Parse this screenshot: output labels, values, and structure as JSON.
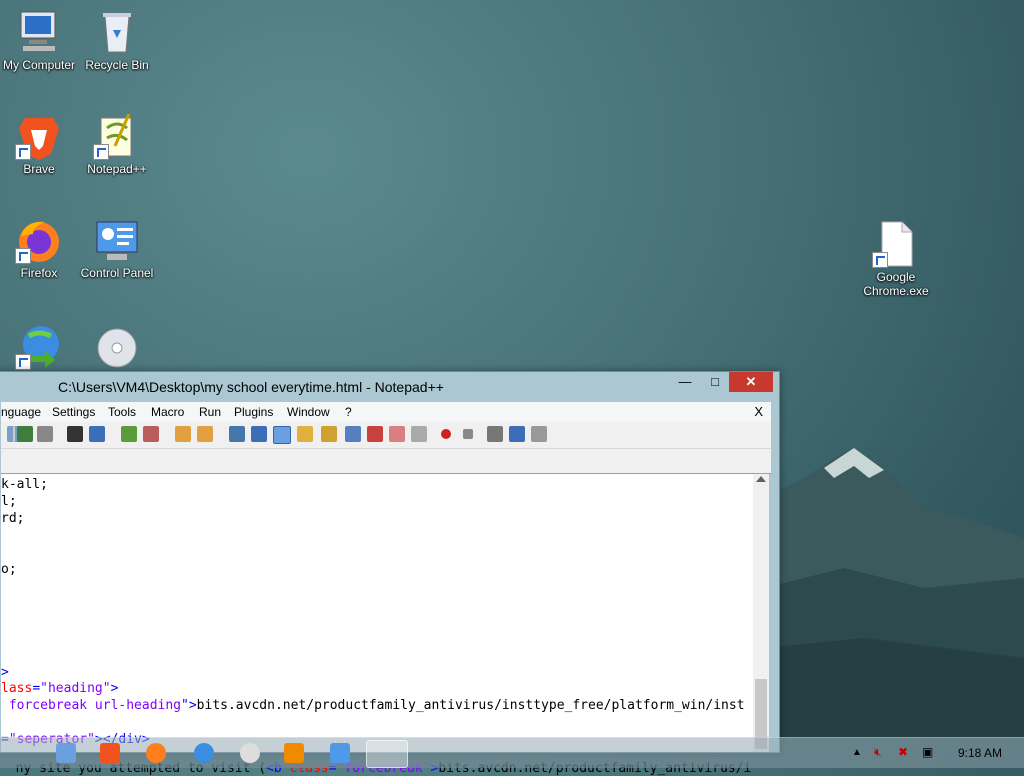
{
  "desktop": {
    "icons": [
      {
        "label": "My Computer",
        "icon": "computer-icon"
      },
      {
        "label": "Recycle Bin",
        "icon": "recycle-bin-icon"
      },
      {
        "label": "Brave",
        "icon": "brave-icon"
      },
      {
        "label": "Notepad++",
        "icon": "notepadpp-icon"
      },
      {
        "label": "Firefox",
        "icon": "firefox-icon"
      },
      {
        "label": "Control Panel",
        "icon": "control-panel-icon"
      },
      {
        "label": "Google Chrome.exe",
        "icon": "file-icon"
      },
      {
        "label": "",
        "icon": "internet-download-icon"
      },
      {
        "label": "",
        "icon": "disc-icon"
      }
    ]
  },
  "window": {
    "title": "C:\\Users\\VM4\\Desktop\\my school everytime.html - Notepad++",
    "menu": [
      "nguage",
      "Settings",
      "Tools",
      "Macro",
      "Run",
      "Plugins",
      "Window",
      "?"
    ],
    "menu_close": "X",
    "controls": {
      "minimize": "—",
      "maximize": "□",
      "close": "✕"
    }
  },
  "editor": {
    "lines": [
      {
        "plain": "k-all;"
      },
      {
        "plain": "l;"
      },
      {
        "plain": "rd;"
      },
      {
        "plain": "o;"
      },
      {
        "plain": ">"
      },
      {
        "attr": "lass",
        "eq": "=",
        "val": "\"heading\"",
        "close": ">"
      },
      {
        "attr": " forcebreak url-heading",
        "close": "\">",
        "text": "bits.avcdn.net/productfamily_antivirus/insttype_free/platform_win/inst"
      },
      {
        "eq": "=",
        "val": "\"seperator\"",
        "close": "></div>"
      },
      {
        "text": "ny site you attempted to visit (",
        "tag": "<b",
        "attr": " class",
        "eq": "=",
        "val": "\"forcebreak\"",
        "close": ">",
        "text2": "bits.avcdn.net/productfamily_antivirus/i"
      }
    ]
  },
  "taskbar": {
    "time": "9:18 AM"
  }
}
